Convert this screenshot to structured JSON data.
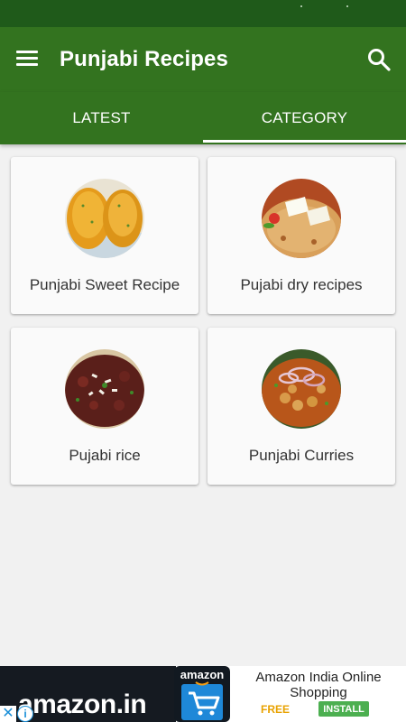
{
  "app": {
    "title": "Punjabi Recipes"
  },
  "tabs": [
    {
      "label": "LATEST",
      "active": false
    },
    {
      "label": "CATEGORY",
      "active": true
    }
  ],
  "categories": [
    {
      "label": "Punjabi Sweet Recipe",
      "image": "fried-dumplings-photo"
    },
    {
      "label": "Pujabi dry recipes",
      "image": "paratha-paneer-photo"
    },
    {
      "label": "Pujabi rice",
      "image": "rice-dish-photo"
    },
    {
      "label": "Punjabi Curries",
      "image": "chole-curry-photo"
    }
  ],
  "ad": {
    "wordmark": "amazon.in",
    "app_brand": "amazon",
    "app_title": "Amazon India Online Shopping",
    "price": "FREE",
    "install_label": "INSTALL",
    "close_glyph": "✕",
    "info_glyph": "i"
  },
  "colors": {
    "toolbar": "#33731f",
    "status_bar": "#1f5a1a",
    "background": "#f1f1f1",
    "card": "#fafafa",
    "install": "#4caf50"
  }
}
